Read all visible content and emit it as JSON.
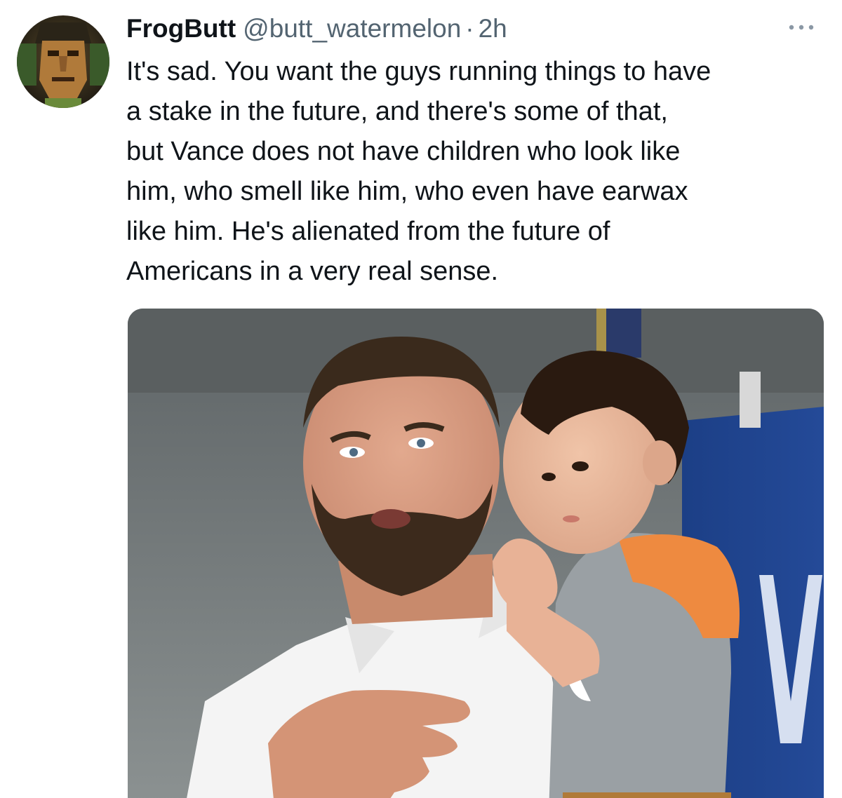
{
  "tweet": {
    "display_name": "FrogButt",
    "handle": "@butt_watermelon",
    "separator": "·",
    "timestamp": "2h",
    "more_icon": "more-horizontal-icon",
    "text": "It's sad. You want the guys running things to have\na stake in the future, and there's some of that,\nbut Vance does not have children who look like\nhim, who smell like him, who even have earwax\nlike him. He's alienated from the future of\nAmericans in a very real sense."
  },
  "colors": {
    "text_primary": "#0f1419",
    "text_secondary": "#536471",
    "background": "#ffffff"
  }
}
